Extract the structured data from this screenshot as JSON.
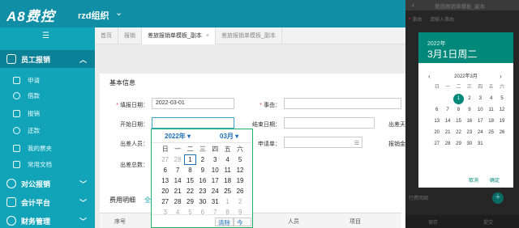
{
  "app": {
    "logo": "A8费控",
    "org": "rzd组织"
  },
  "sidebar": {
    "toggle": "☰",
    "sections": [
      {
        "label": "员工报销",
        "expanded": true
      },
      {
        "label": "对公报销",
        "expanded": false
      },
      {
        "label": "会计平台",
        "expanded": false
      },
      {
        "label": "财务管理",
        "expanded": false
      }
    ],
    "items": [
      "申请",
      "借款",
      "报销",
      "还款",
      "我的票夹",
      "常用文档"
    ]
  },
  "tabs": [
    "首页",
    "报销",
    "差旅报销单模板_副本",
    "差旅报销单模板_副本"
  ],
  "form": {
    "section_title": "基本信息",
    "fill_date_label": "填报日期：",
    "fill_date_value": "2022-03-01",
    "reason_label": "事由：",
    "start_date_label": "开始日期：",
    "end_date_label": "结束日期：",
    "trip_days_label": "出差天",
    "traveler_label": "出差人员：",
    "apply_label": "申请单：",
    "amount_label": "报销金",
    "total_days_label": "出差总数："
  },
  "fee": {
    "title": "费用明细",
    "all": "全",
    "columns": [
      "序号",
      "人员",
      "项目"
    ]
  },
  "picker": {
    "year": "2022年",
    "month": "03月",
    "weekdays": [
      "日",
      "一",
      "二",
      "三",
      "四",
      "五",
      "六"
    ],
    "weeks": [
      [
        "27",
        "28",
        "1",
        "2",
        "3",
        "4",
        "5"
      ],
      [
        "6",
        "7",
        "8",
        "9",
        "10",
        "11",
        "12"
      ],
      [
        "13",
        "14",
        "15",
        "16",
        "17",
        "18",
        "19"
      ],
      [
        "20",
        "21",
        "22",
        "23",
        "24",
        "25",
        "26"
      ],
      [
        "27",
        "28",
        "29",
        "30",
        "31",
        "1",
        "2"
      ],
      [
        "3",
        "4",
        "5",
        "6",
        "7",
        "8",
        "9"
      ]
    ],
    "clear": "清除",
    "today": "今天"
  },
  "mobile": {
    "header_title": "差旅报销单模板_副本",
    "reason_hint": "事由",
    "reason_placeholder": "请输入事由",
    "dialog_year": "2022年",
    "dialog_date": "3月1日周二",
    "dialog_month": "2022年3月",
    "weekdays": [
      "日",
      "一",
      "二",
      "三",
      "四",
      "五",
      "六"
    ],
    "weeks": [
      [
        "",
        "",
        "1",
        "2",
        "3",
        "4",
        "5"
      ],
      [
        "6",
        "7",
        "8",
        "9",
        "10",
        "11",
        "12"
      ],
      [
        "13",
        "14",
        "15",
        "16",
        "17",
        "18",
        "19"
      ],
      [
        "20",
        "21",
        "22",
        "23",
        "24",
        "25",
        "26"
      ],
      [
        "27",
        "28",
        "29",
        "30",
        "31",
        "",
        ""
      ]
    ],
    "cancel": "取消",
    "ok": "确定",
    "fee_label": "行费明细",
    "bottom_left": "保存",
    "bottom_right": "提交"
  },
  "colors": {
    "sidebar": "#11a3b8",
    "topbar": "#0f8ea5",
    "picker_border": "#1fb06c",
    "mobile_accent": "#00897b"
  }
}
